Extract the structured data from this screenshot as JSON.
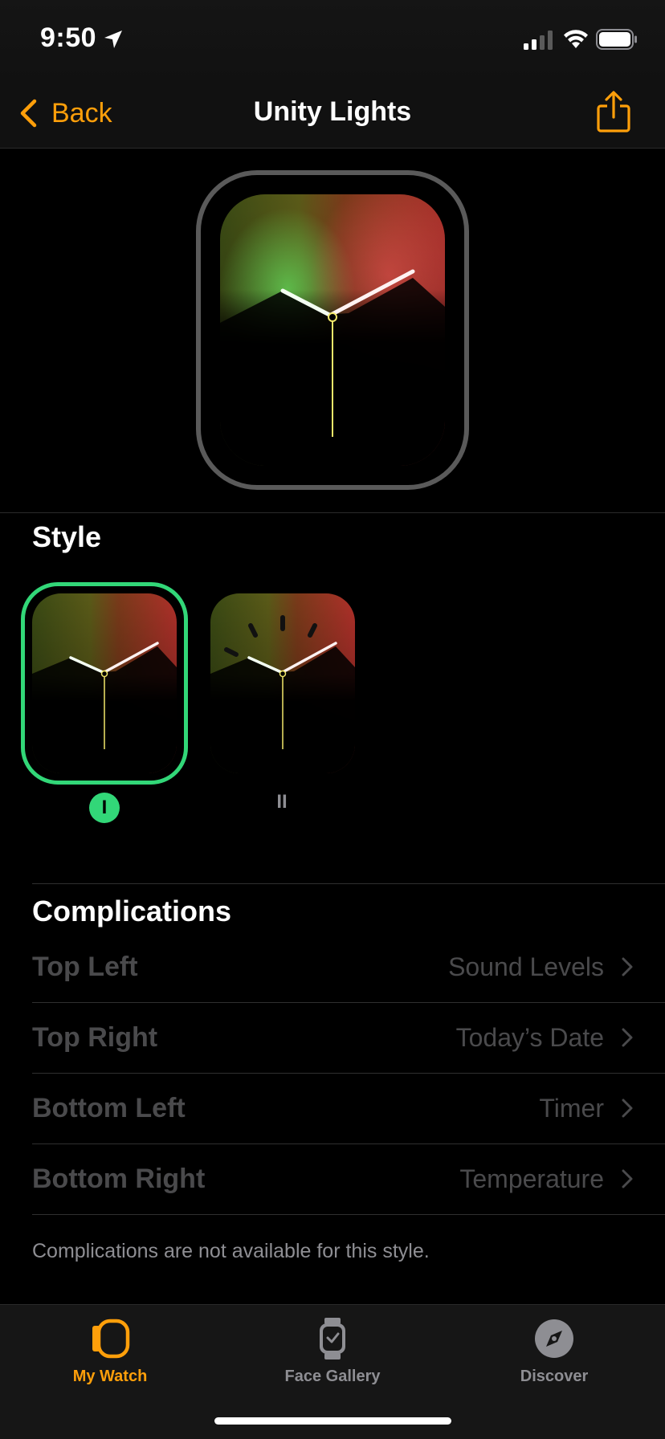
{
  "status_bar": {
    "time": "9:50",
    "icons": [
      "location-arrow-icon",
      "cellular-signal-icon",
      "wifi-icon",
      "battery-icon"
    ]
  },
  "nav": {
    "back_label": "Back",
    "title": "Unity Lights",
    "share_icon": "share-icon"
  },
  "colors": {
    "accent": "#ff9f0a",
    "selection": "#32d778",
    "muted_text": "#4a4a4c",
    "secondary_text": "#8e8e93"
  },
  "style": {
    "section_title": "Style",
    "options": [
      {
        "label": "I",
        "selected": true
      },
      {
        "label": "II",
        "selected": false
      }
    ]
  },
  "complications": {
    "section_title": "Complications",
    "rows": [
      {
        "label": "Top Left",
        "value": "Sound Levels"
      },
      {
        "label": "Top Right",
        "value": "Today’s Date"
      },
      {
        "label": "Bottom Left",
        "value": "Timer"
      },
      {
        "label": "Bottom Right",
        "value": "Temperature"
      }
    ],
    "note": "Complications are not available for this style."
  },
  "tabs": [
    {
      "label": "My Watch",
      "icon": "watch-active-icon",
      "active": true
    },
    {
      "label": "Face Gallery",
      "icon": "watch-face-icon",
      "active": false
    },
    {
      "label": "Discover",
      "icon": "compass-icon",
      "active": false
    }
  ]
}
